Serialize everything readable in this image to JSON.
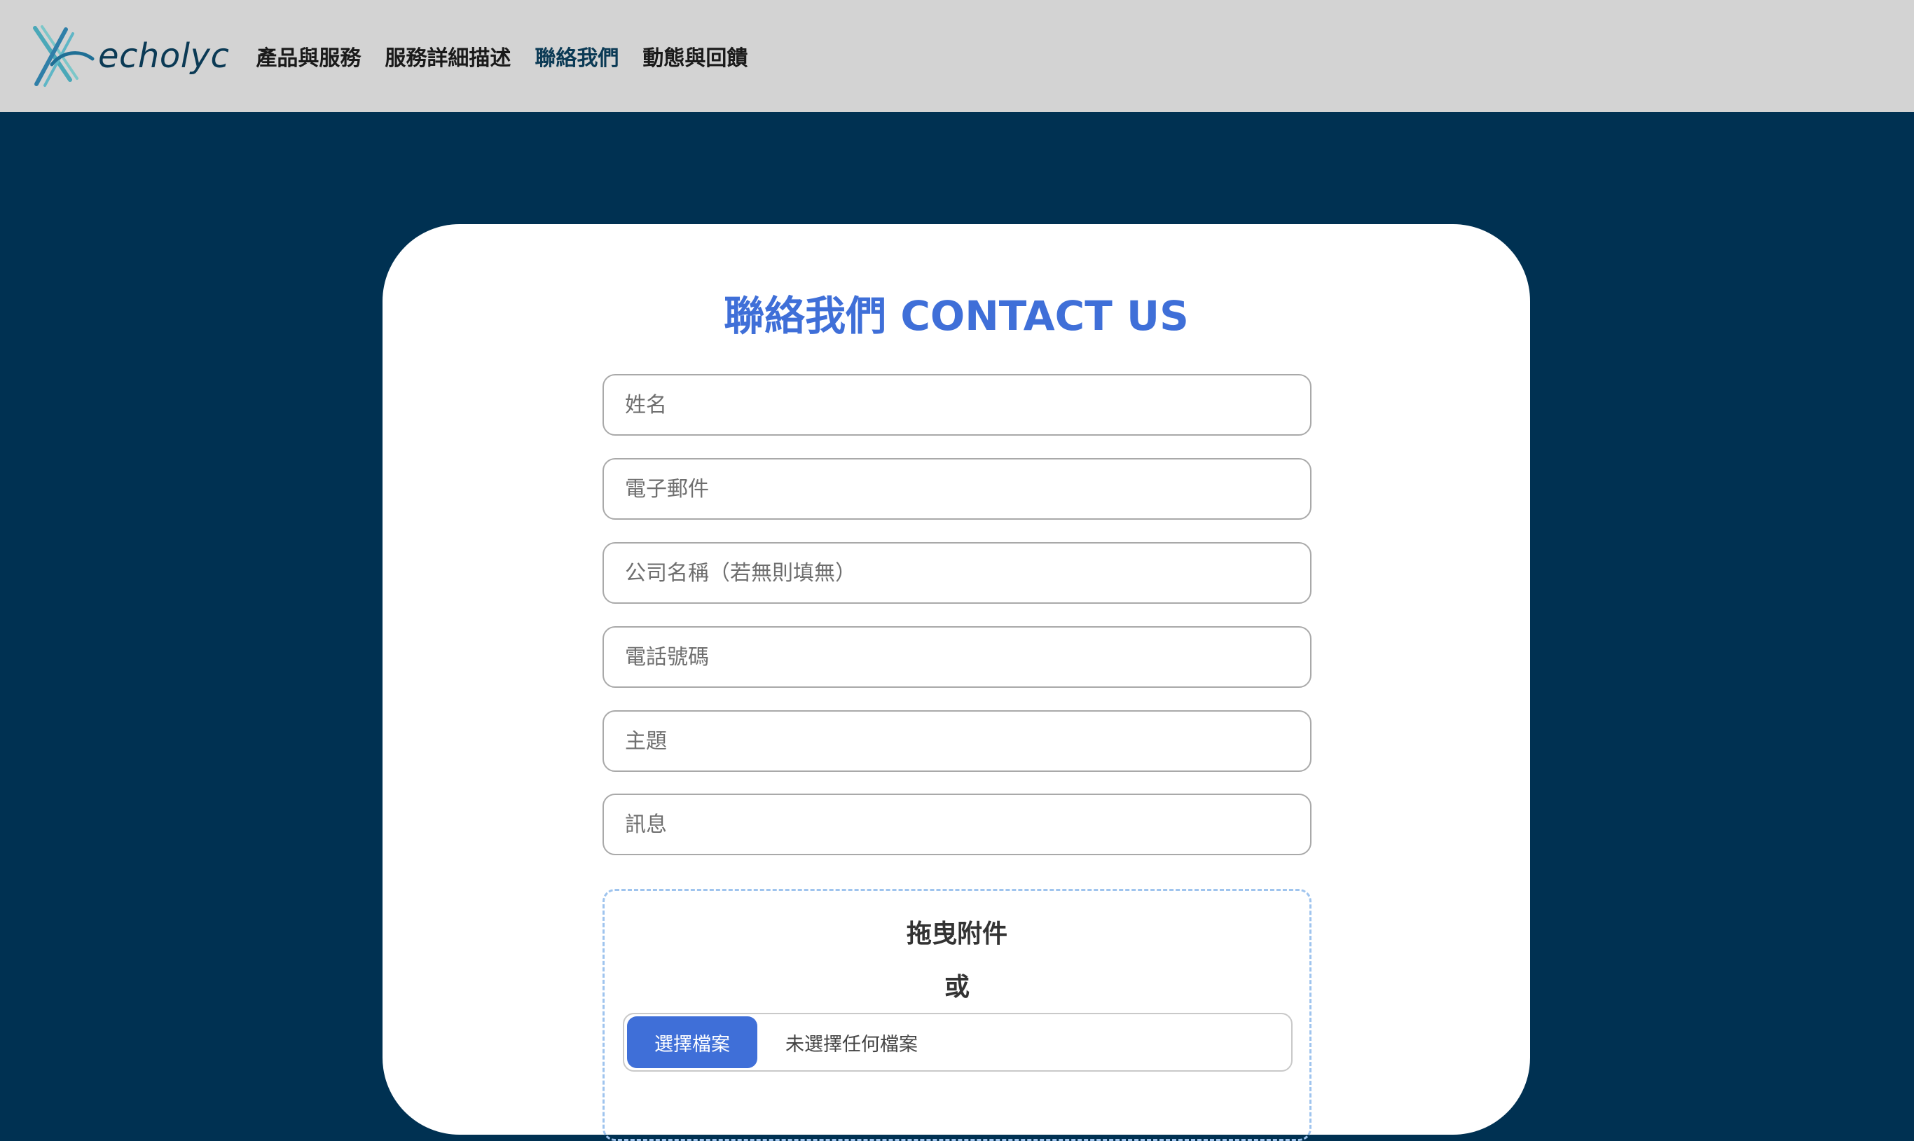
{
  "navbar": {
    "brand": "echolyc",
    "links": [
      {
        "label": "產品與服務"
      },
      {
        "label": "服務詳細描述"
      },
      {
        "label": "聯絡我們"
      },
      {
        "label": "動態與回饋"
      }
    ]
  },
  "form": {
    "title": "聯絡我們 CONTACT US",
    "fields": {
      "name": {
        "placeholder": "姓名",
        "value": ""
      },
      "email": {
        "placeholder": "電子郵件",
        "value": ""
      },
      "company": {
        "placeholder": "公司名稱（若無則填無）",
        "value": ""
      },
      "phone": {
        "placeholder": "電話號碼",
        "value": ""
      },
      "subject": {
        "placeholder": "主題",
        "value": ""
      },
      "message": {
        "placeholder": "訊息",
        "value": ""
      }
    },
    "attachment": {
      "drop_label": "拖曳附件",
      "or_label": "或",
      "button_label": "選擇檔案",
      "status": "未選擇任何檔案"
    }
  },
  "colors": {
    "page_background": "#003152",
    "navbar_background": "#d3d3d3",
    "accent": "#3f6fd8",
    "active_link": "#0b3a55"
  }
}
